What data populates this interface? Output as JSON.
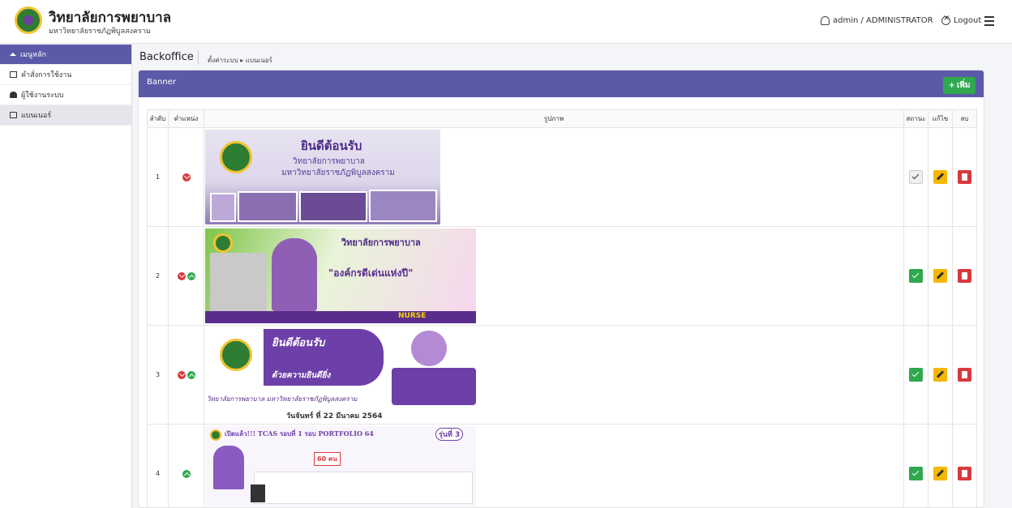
{
  "header": {
    "title": "วิทยาลัยการพยาบาล",
    "subtitle": "มหาวิทยาลัยราชภัฏพิบูลสงคราม",
    "user": "admin / ADMINISTRATOR",
    "logout": "Logout"
  },
  "sidebar": {
    "items": [
      {
        "label": "เมนูหลัก",
        "icon": "home-icon"
      },
      {
        "label": "คำสั่งการใช้งาน",
        "icon": "document-icon"
      },
      {
        "label": "ผู้ใช้งานระบบ",
        "icon": "user-icon"
      },
      {
        "label": "แบนเนอร์",
        "icon": "image-icon"
      }
    ]
  },
  "breadcrumb": {
    "title": "Backoffice",
    "path": "ตั้งค่าระบบ ▸ แบนเนอร์"
  },
  "panel": {
    "title": "Banner",
    "add_label": "เพิ่ม"
  },
  "table": {
    "headers": {
      "no": "ลำดับ",
      "position": "ตำแหน่ง",
      "image": "รูปภาพ",
      "status": "สถานะ",
      "edit": "แก้ไข",
      "delete": "ลบ"
    },
    "rows": [
      {
        "no": "1",
        "status_active": false,
        "banner": {
          "line1": "ยินดีต้อนรับ",
          "line2": "วิทยาลัยการพยาบาล",
          "line3": "มหาวิทยาลัยราชภัฏพิบูลสงคราม"
        }
      },
      {
        "no": "2",
        "status_active": true,
        "banner": {
          "line1": "วิทยาลัยการพยาบาล",
          "line2": "\"องค์กรดีเด่นแห่งปี\"",
          "line3": "NURSE"
        }
      },
      {
        "no": "3",
        "status_active": true,
        "banner": {
          "line1": "ยินดีต้อนรับ",
          "line2": "ด้วยความยินดียิ่ง",
          "line3": "วิทยาลัยการพยาบาล มหาวิทยาลัยราชภัฏพิบูลสงคราม",
          "line4": "วันจันทร์ ที่ 22 มีนาคม 2564"
        }
      },
      {
        "no": "4",
        "status_active": true,
        "banner": {
          "line1": "เปิดแล้ว!!! TCAS รอบที่ 1 รอบ PORTFOLIO 64",
          "line2": "รุ่นที่ 3",
          "line3": "60 คน"
        }
      }
    ]
  },
  "colors": {
    "accent": "#5b5aa8",
    "success": "#2fa84f",
    "warning": "#f5b800",
    "danger": "#d8393d"
  }
}
